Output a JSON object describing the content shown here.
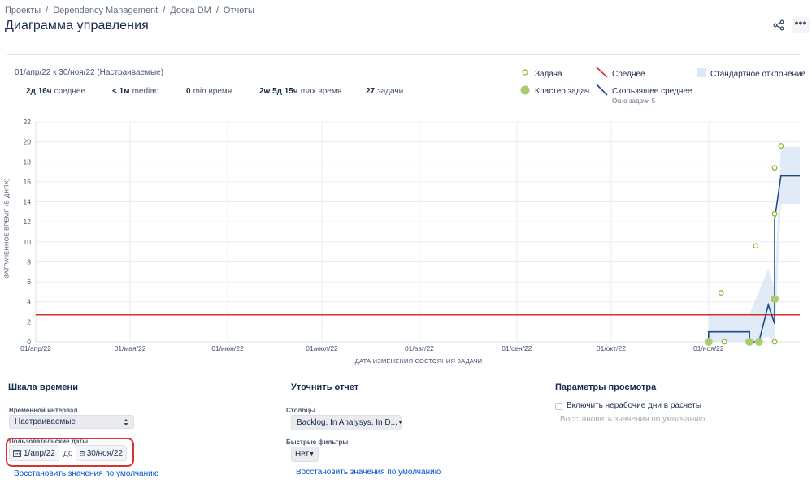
{
  "breadcrumb": [
    "Проекты",
    "Dependency Management",
    "Доска DM",
    "Отчеты"
  ],
  "page_title": "Диаграмма управления",
  "header_icons": {
    "share": "share-icon",
    "more": "more-icon",
    "more_text": "•••"
  },
  "summary": {
    "date_range": "01/апр/22 к 30/ноя/22 (Настраиваемые)",
    "stats": [
      {
        "value": "2д 16ч",
        "label": "среднее"
      },
      {
        "value": "< 1м",
        "label": "median"
      },
      {
        "value": "0",
        "label": "min время"
      },
      {
        "value": "2w 5д 15ч",
        "label": "max время"
      },
      {
        "value": "27",
        "label": "задачи"
      }
    ]
  },
  "legend": {
    "issue": "Задача",
    "cluster": "Кластер задач",
    "average": "Среднее",
    "rolling_average": "Скользящее среднее",
    "rolling_window": "Окно задачи 5",
    "std_dev": "Стандартное отклонение"
  },
  "colors": {
    "average_line": "#d0322c",
    "rolling_line": "#1d4a8c",
    "issue_point": "#8bb32a",
    "cluster_point": "#a9cc70",
    "std_band": "#dbe8f6",
    "link": "#0052cc",
    "highlight": "#d9342b"
  },
  "chart_data": {
    "type": "scatter",
    "title": "",
    "xlabel": "ДАТА ИЗМЕНЕНИЯ СОСТОЯНИЯ ЗАДАЧИ",
    "ylabel": "ЗАТРАЧЕННОЕ ВРЕМЯ (В ДНЯХ)",
    "x_ticks": [
      "01/апр/22",
      "01/мая/22",
      "01/июн/22",
      "01/июл/22",
      "01/авг/22",
      "01/сен/22",
      "01/окт/22",
      "01/ноя/22"
    ],
    "y_ticks": [
      0,
      2,
      4,
      6,
      8,
      10,
      12,
      14,
      16,
      18,
      20,
      22
    ],
    "ylim": [
      0,
      22
    ],
    "xlim": [
      "2022-04-01",
      "2022-11-30"
    ],
    "average": 2.7,
    "issues": [
      {
        "x": "2022-11-05",
        "y": 4.9
      },
      {
        "x": "2022-11-06",
        "y": 0
      },
      {
        "x": "2022-11-16",
        "y": 9.6
      },
      {
        "x": "2022-11-22",
        "y": 0
      },
      {
        "x": "2022-11-22",
        "y": 12.8
      },
      {
        "x": "2022-11-22",
        "y": 17.4
      },
      {
        "x": "2022-11-24",
        "y": 19.6
      }
    ],
    "clusters": [
      {
        "x": "2022-11-01",
        "y": 0
      },
      {
        "x": "2022-11-14",
        "y": 0
      },
      {
        "x": "2022-11-17",
        "y": 0
      },
      {
        "x": "2022-11-22",
        "y": 4.3
      }
    ],
    "rolling_average": [
      {
        "x": "2022-11-01",
        "y": 0
      },
      {
        "x": "2022-11-01",
        "y": 1
      },
      {
        "x": "2022-11-14",
        "y": 1
      },
      {
        "x": "2022-11-14",
        "y": 0
      },
      {
        "x": "2022-11-17",
        "y": 0
      },
      {
        "x": "2022-11-20",
        "y": 3.7
      },
      {
        "x": "2022-11-22",
        "y": 1.8
      },
      {
        "x": "2022-11-22",
        "y": 12.2
      },
      {
        "x": "2022-11-24",
        "y": 16.6
      },
      {
        "x": "2022-11-30",
        "y": 16.6
      }
    ],
    "std_band": [
      {
        "x": "2022-11-01",
        "low": 0,
        "high": 2.8
      },
      {
        "x": "2022-11-14",
        "low": 0,
        "high": 2.8
      },
      {
        "x": "2022-11-20",
        "low": 0.5,
        "high": 7.3
      },
      {
        "x": "2022-11-22",
        "low": 0,
        "high": 5.2
      },
      {
        "x": "2022-11-24",
        "low": 13.8,
        "high": 19.5
      },
      {
        "x": "2022-11-30",
        "low": 13.8,
        "high": 19.5
      }
    ]
  },
  "timeframe": {
    "title": "Шкала времени",
    "interval_label": "Временной интервал",
    "interval_value": "Настраиваемые",
    "custom_dates_label": "Пользовательские даты",
    "from": "1/апр/22",
    "to_word": "до",
    "to": "30/ноя/22",
    "reset": "Восстановить значения по умолчанию"
  },
  "refine": {
    "title": "Уточнить отчет",
    "columns_label": "Столбцы",
    "columns_value": "Backlog, In Analysys, In D...",
    "filters_label": "Быстрые фильтры",
    "filters_value": "Нет",
    "reset": "Восстановить значения по умолчанию"
  },
  "view": {
    "title": "Параметры просмотра",
    "nonworking": "Включить нерабочие дни в расчеты",
    "reset": "Восстановить значения по умолчанию"
  }
}
